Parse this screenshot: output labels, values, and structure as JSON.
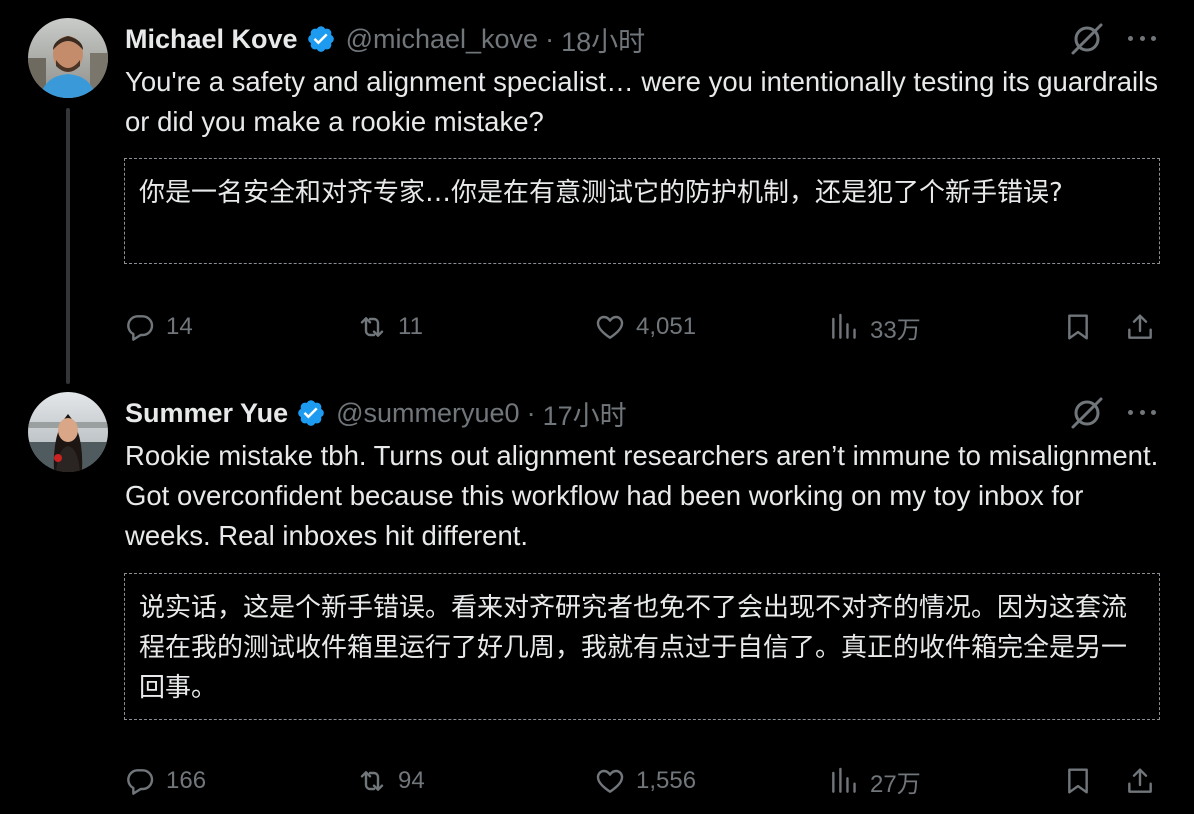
{
  "tweets": [
    {
      "author_name": "Michael Kove",
      "handle": "@michael_kove",
      "separator": "·",
      "time": "18小时",
      "text": "You're a safety and alignment specialist… were you intentionally testing its guardrails or did you make a rookie mistake?",
      "translation": "你是一名安全和对齐专家…你是在有意测试它的防护机制，还是犯了个新手错误?",
      "replies": "14",
      "reposts": "11",
      "likes": "4,051",
      "views": "33万"
    },
    {
      "author_name": "Summer Yue",
      "handle": "@summeryue0",
      "separator": "·",
      "time": "17小时",
      "text": "Rookie mistake tbh. Turns out alignment researchers aren’t immune to misalignment. Got overconfident because this workflow had been working on my toy inbox for weeks. Real inboxes hit different.",
      "translation": "说实话，这是个新手错误。看来对齐研究者也免不了会出现不对齐的情况。因为这套流程在我的测试收件箱里运行了好几周，我就有点过于自信了。真正的收件箱完全是另一回事。",
      "replies": "166",
      "reposts": "94",
      "likes": "1,556",
      "views": "27万"
    }
  ],
  "colors": {
    "background": "#000000",
    "text": "#e7e9ea",
    "muted": "#71767b",
    "verified": "#1d9bf0",
    "thread_line": "#333639"
  },
  "icons": [
    "verified-badge-icon",
    "grok-icon",
    "more-icon",
    "reply-icon",
    "repost-icon",
    "like-icon",
    "views-icon",
    "bookmark-icon",
    "share-icon"
  ]
}
